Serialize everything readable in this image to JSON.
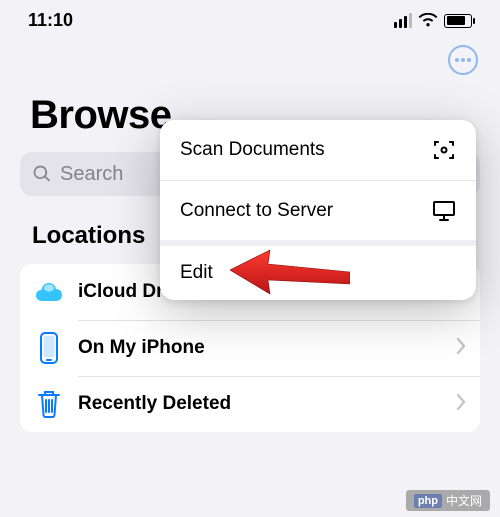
{
  "status": {
    "time": "11:10"
  },
  "header": {
    "title": "Browse"
  },
  "search": {
    "placeholder": "Search"
  },
  "popup": {
    "items": [
      {
        "label": "Scan Documents"
      },
      {
        "label": "Connect to Server"
      },
      {
        "label": "Edit"
      }
    ]
  },
  "locations": {
    "title": "Locations",
    "items": [
      {
        "label": "iCloud Drive"
      },
      {
        "label": "On My iPhone"
      },
      {
        "label": "Recently Deleted"
      }
    ]
  },
  "watermark": {
    "brand": "php",
    "text": "中文网"
  }
}
